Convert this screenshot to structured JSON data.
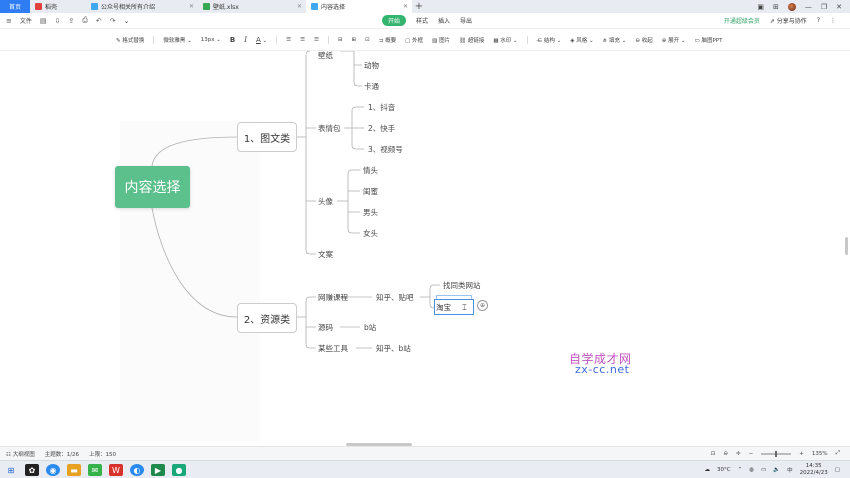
{
  "tabs": {
    "home": "首页",
    "t1": "稻壳",
    "t2": "公众号相关所有介绍",
    "t3": "壁纸.xlsx",
    "current": "内容选择",
    "add": "+"
  },
  "menu": {
    "file": "文件",
    "start": "开始",
    "style": "样式",
    "insert": "插入",
    "export": "导出",
    "vip": "开通超级会员",
    "share": "分享与协作"
  },
  "toolbar": {
    "format_brush": "格式替换",
    "font": "微软雅黑",
    "size": "13px",
    "bold": "B",
    "italic": "I",
    "font_color": "A",
    "summary": "概要",
    "outline": "外框",
    "image": "图片",
    "link": "超链接",
    "watermark": "水印",
    "layout": "结构",
    "theme": "风格",
    "fill": "填充",
    "collapse": "收起",
    "expand": "展开",
    "ppt": "脑图PPT"
  },
  "mindmap": {
    "root": "内容选择",
    "cat1": "1、图文类",
    "cat2": "2、资源类",
    "wallpaper": "壁纸",
    "animal": "动物",
    "cartoon": "卡通",
    "sticker": "表情包",
    "douyin": "1、抖音",
    "kuaishou": "2、快手",
    "shipinhao": "3、视频号",
    "avatar": "头像",
    "couple": "情头",
    "bestie": "闺蜜",
    "male": "男头",
    "female": "女头",
    "copy": "文案",
    "course": "网赚课程",
    "zhihu_tieba": "知乎、贴吧",
    "find_sites": "找同类网站",
    "taobao": "淘宝",
    "source": "源码",
    "bilibili": "b站",
    "tools": "某些工具",
    "zhihu_bili": "知乎、b站"
  },
  "watermark": {
    "line1": "自学成才网",
    "line2": "zx-cc.net"
  },
  "statusbar": {
    "outline_view": "大纲视图",
    "topics": "主题数：1/26",
    "upload": "上限：150",
    "zoom": "135%"
  },
  "taskbar": {
    "weather": "30°C",
    "time": "14:35",
    "date": "2022/4/23"
  },
  "colors": {
    "root": "#5cc08c",
    "accent": "#2e7df5",
    "green": "#34b56f"
  }
}
